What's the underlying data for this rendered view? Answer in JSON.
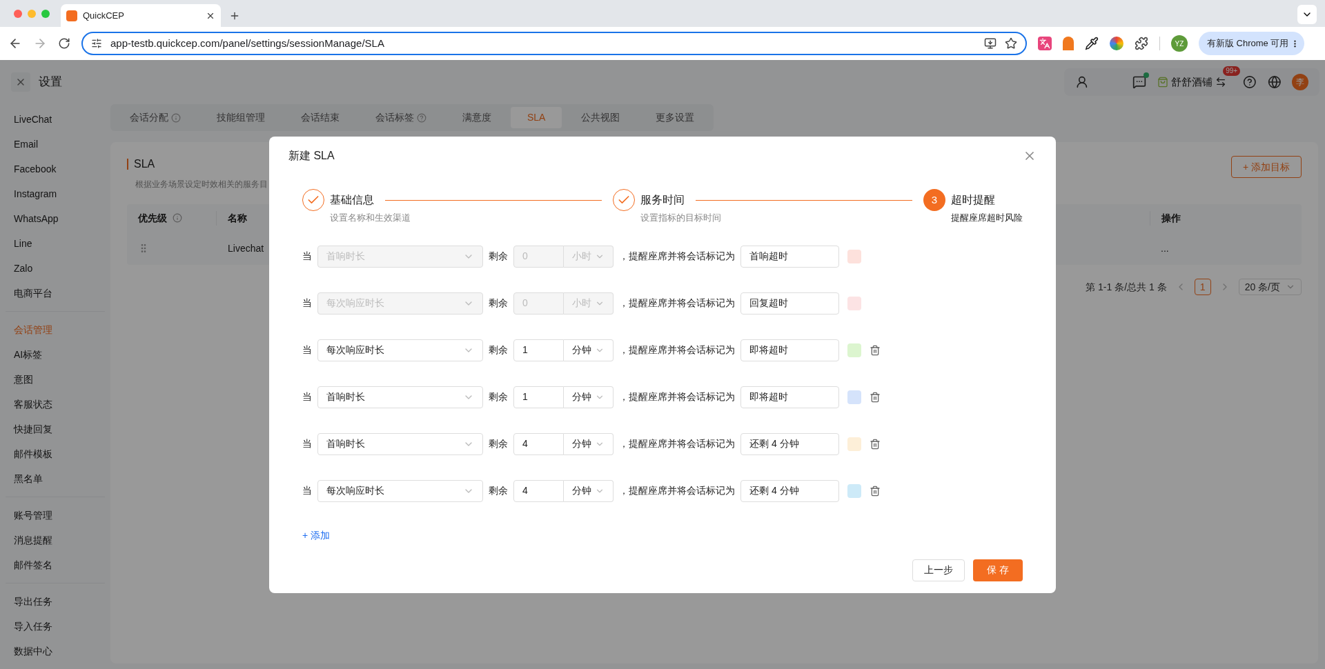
{
  "browser": {
    "tab_title": "QuickCEP",
    "url": "app-testb.quickcep.com/panel/settings/sessionManage/SLA",
    "profile": "YZ",
    "update_button": "有新版 Chrome 可用"
  },
  "header": {
    "title": "设置",
    "shop_name": "舒舒酒铺",
    "badge": "99+",
    "avatar": "李"
  },
  "sidebar": {
    "groups": [
      [
        {
          "label": "LiveChat",
          "selected": false
        },
        {
          "label": "Email",
          "selected": false
        },
        {
          "label": "Facebook",
          "selected": false
        },
        {
          "label": "Instagram",
          "selected": false
        },
        {
          "label": "WhatsApp",
          "selected": false
        },
        {
          "label": "Line",
          "selected": false
        },
        {
          "label": "Zalo",
          "selected": false
        },
        {
          "label": "电商平台",
          "selected": false
        }
      ],
      [
        {
          "label": "会话管理",
          "selected": true
        },
        {
          "label": "AI标签",
          "selected": false
        },
        {
          "label": "意图",
          "selected": false
        },
        {
          "label": "客服状态",
          "selected": false
        },
        {
          "label": "快捷回复",
          "selected": false
        },
        {
          "label": "邮件模板",
          "selected": false
        },
        {
          "label": "黑名单",
          "selected": false
        }
      ],
      [
        {
          "label": "账号管理",
          "selected": false
        },
        {
          "label": "消息提醒",
          "selected": false
        },
        {
          "label": "邮件签名",
          "selected": false
        }
      ],
      [
        {
          "label": "导出任务",
          "selected": false
        },
        {
          "label": "导入任务",
          "selected": false
        },
        {
          "label": "数据中心",
          "selected": false
        }
      ]
    ]
  },
  "tabs": [
    {
      "label": "会话分配",
      "info_icon": true,
      "help_icon": false,
      "selected": false
    },
    {
      "label": "技能组管理",
      "info_icon": false,
      "help_icon": false,
      "selected": false
    },
    {
      "label": "会话结束",
      "info_icon": false,
      "help_icon": false,
      "selected": false
    },
    {
      "label": "会话标签",
      "info_icon": false,
      "help_icon": true,
      "selected": false
    },
    {
      "label": "满意度",
      "info_icon": false,
      "help_icon": false,
      "selected": false
    },
    {
      "label": "SLA",
      "info_icon": false,
      "help_icon": false,
      "selected": true
    },
    {
      "label": "公共视图",
      "info_icon": false,
      "help_icon": false,
      "selected": false
    },
    {
      "label": "更多设置",
      "info_icon": false,
      "help_icon": false,
      "selected": false
    }
  ],
  "page": {
    "title": "SLA",
    "description": "根据业务场景设定时效相关的服务目",
    "add_button": "+ 添加目标",
    "table": {
      "columns": [
        {
          "label": "优先级",
          "info_icon": true
        },
        {
          "label": "名称",
          "info_icon": false
        },
        {
          "label": "操作",
          "info_icon": false
        }
      ],
      "rows": [
        {
          "name": "Livechat",
          "actions": "..."
        }
      ]
    },
    "pagination": {
      "summary": "第 1-1 条/总共 1 条",
      "pages": [
        {
          "label": "1",
          "selected": true
        }
      ],
      "page_size": "20 条/页"
    }
  },
  "modal": {
    "title": "新建 SLA",
    "steps": [
      {
        "title": "基础信息",
        "subtitle": "设置名称和生效渠道",
        "done": true
      },
      {
        "title": "服务时间",
        "subtitle": "设置指标的目标时间",
        "done": true
      },
      {
        "number": "3",
        "title": "超时提醒",
        "subtitle": "提醒座席超时风险",
        "done": false
      }
    ],
    "rules": [
      {
        "when": "当",
        "metric": "首响时长",
        "remain": "剩余",
        "amount": "0",
        "unit": "小时",
        "action": "，提醒座席并将会话标记为",
        "tag": "首响超时",
        "color": "#fde1dc",
        "disabled": true,
        "deletable": false
      },
      {
        "when": "当",
        "metric": "每次响应时长",
        "remain": "剩余",
        "amount": "0",
        "unit": "小时",
        "action": "，提醒座席并将会话标记为",
        "tag": "回复超时",
        "color": "#fce3e4",
        "disabled": true,
        "deletable": false
      },
      {
        "when": "当",
        "metric": "每次响应时长",
        "remain": "剩余",
        "amount": "1",
        "unit": "分钟",
        "action": "，提醒座席并将会话标记为",
        "tag": "即将超时",
        "color": "#dcf5cf",
        "disabled": false,
        "deletable": true
      },
      {
        "when": "当",
        "metric": "首响时长",
        "remain": "剩余",
        "amount": "1",
        "unit": "分钟",
        "action": "，提醒座席并将会话标记为",
        "tag": "即将超时",
        "color": "#d5e3fb",
        "disabled": false,
        "deletable": true
      },
      {
        "when": "当",
        "metric": "首响时长",
        "remain": "剩余",
        "amount": "4",
        "unit": "分钟",
        "action": "，提醒座席并将会话标记为",
        "tag": "还剩 4 分钟",
        "color": "#fdefd8",
        "disabled": false,
        "deletable": true
      },
      {
        "when": "当",
        "metric": "每次响应时长",
        "remain": "剩余",
        "amount": "4",
        "unit": "分钟",
        "action": "，提醒座席并将会话标记为",
        "tag": "还剩 4 分钟",
        "color": "#cdeaf8",
        "disabled": false,
        "deletable": true
      }
    ],
    "add_link": "+ 添加",
    "back_button": "上一步",
    "save_button": "保 存"
  }
}
